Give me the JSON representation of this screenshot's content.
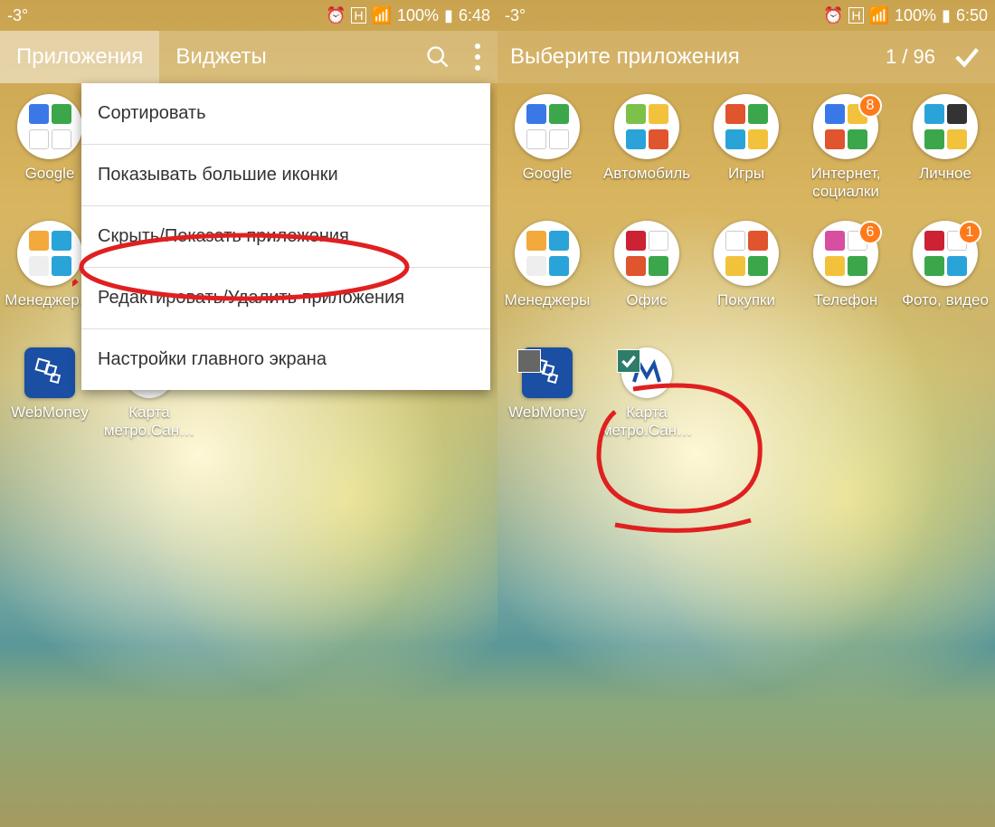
{
  "left": {
    "status": {
      "temp": "-3°",
      "battery": "100%",
      "time": "6:48",
      "has_data": true,
      "has_alarm": true
    },
    "tabs": {
      "apps": "Приложения",
      "widgets": "Виджеты"
    },
    "menu": [
      "Сортировать",
      "Показывать большие иконки",
      "Скрыть/Показать приложения",
      "Редактировать/Удалить приложения",
      "Настройки главного экрана"
    ],
    "apps": {
      "google": "Google",
      "managers": "Менеджер…",
      "webmoney": "WebMoney",
      "metro": "Карта метро.Сан…"
    }
  },
  "right": {
    "status": {
      "temp": "-3°",
      "battery": "100%",
      "time": "6:50",
      "has_data": true,
      "has_alarm": true
    },
    "title": "Выберите приложения",
    "counter": "1 / 96",
    "apps": {
      "google": "Google",
      "auto": "Автомобиль",
      "games": "Игры",
      "inet": "Интернет, социалки",
      "personal": "Личное",
      "managers": "Менеджеры",
      "office": "Офис",
      "shop": "Покупки",
      "phone": "Телефон",
      "photo": "Фото, видео",
      "webmoney": "WebMoney",
      "metro": "Карта метро.Сан…"
    },
    "badges": {
      "inet": "8",
      "phone": "6",
      "photo": "1"
    }
  }
}
